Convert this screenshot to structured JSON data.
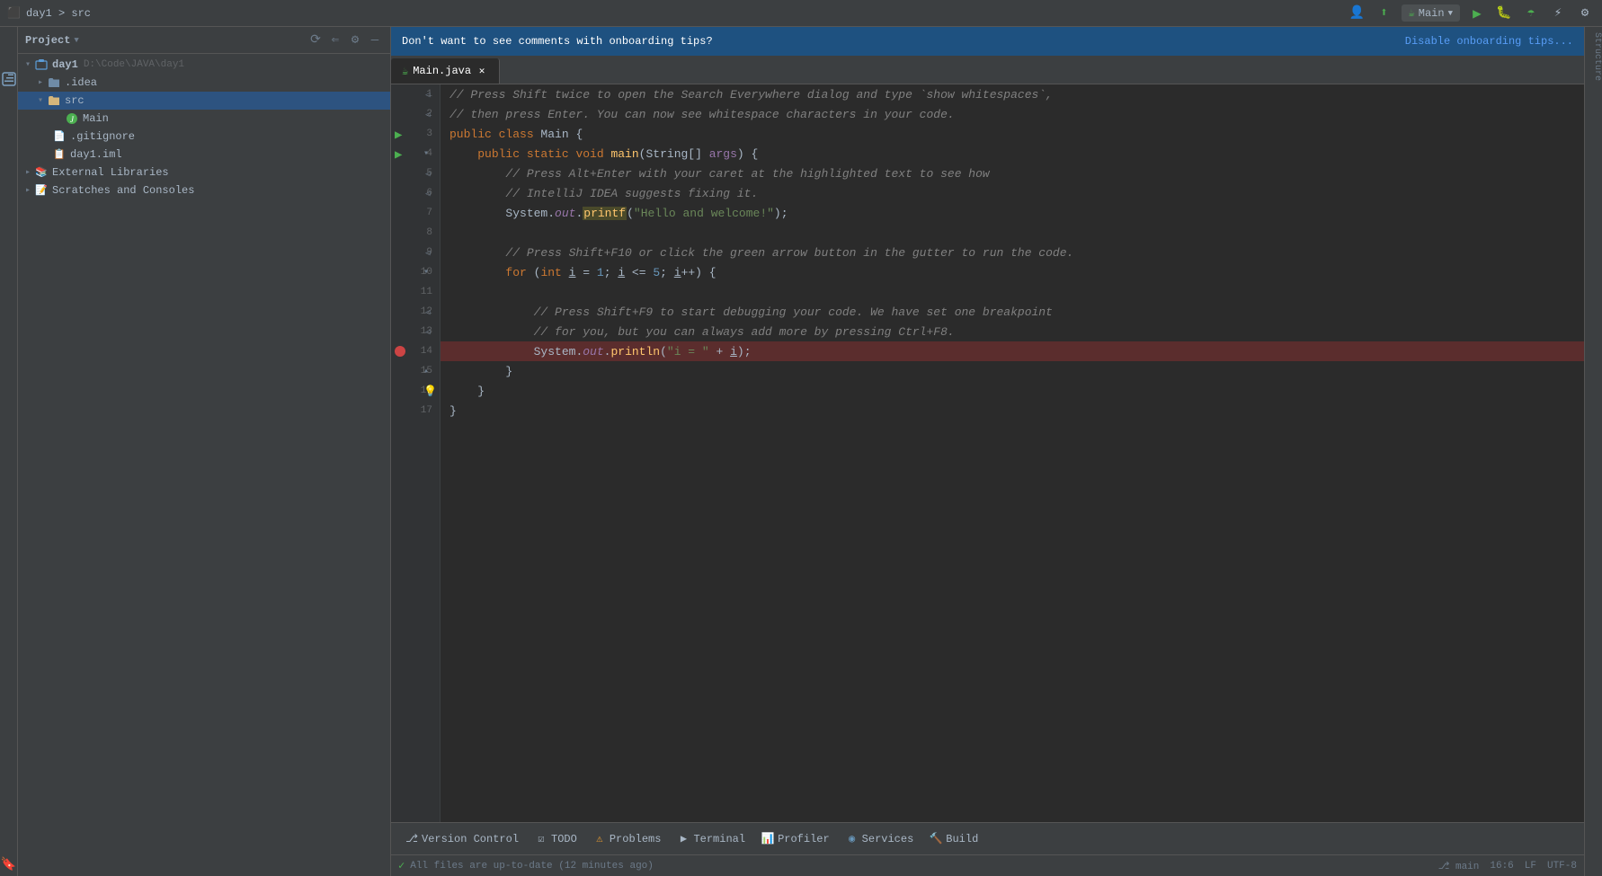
{
  "titleBar": {
    "breadcrumb": "day1 > src",
    "runConfig": {
      "label": "Main",
      "dropdownIcon": "▼"
    },
    "buttons": {
      "updateButton": "⬆",
      "runButton": "▶",
      "debugButton": "🐛",
      "coverageButton": "☂",
      "profileButton": "⚡",
      "settingsButton": "⚙",
      "accountButton": "👤",
      "minimizeButton": "—",
      "maximizeButton": "□",
      "closeButton": "✕"
    }
  },
  "notification": {
    "text": "Don't want to see comments with onboarding tips?",
    "action": "Disable onboarding tips..."
  },
  "tabs": [
    {
      "label": "Main.java",
      "active": true,
      "icon": "☕"
    }
  ],
  "projectPanel": {
    "title": "Project",
    "tree": [
      {
        "level": 0,
        "label": "day1",
        "path": "D:\\Code\\JAVA\\day1",
        "type": "module",
        "expanded": true,
        "selected": false
      },
      {
        "level": 1,
        "label": ".idea",
        "type": "folder",
        "expanded": false,
        "selected": false
      },
      {
        "level": 1,
        "label": "src",
        "type": "folder-src",
        "expanded": true,
        "selected": true
      },
      {
        "level": 2,
        "label": "Main",
        "type": "java",
        "selected": false
      },
      {
        "level": 1,
        "label": ".gitignore",
        "type": "gitignore",
        "selected": false
      },
      {
        "level": 1,
        "label": "day1.iml",
        "type": "iml",
        "selected": false
      },
      {
        "level": 0,
        "label": "External Libraries",
        "type": "ext-lib",
        "expanded": false,
        "selected": false
      },
      {
        "level": 0,
        "label": "Scratches and Consoles",
        "type": "scratches",
        "expanded": false,
        "selected": false
      }
    ]
  },
  "editor": {
    "lines": [
      {
        "num": 1,
        "content": "// Press Shift twice to open the Search Everywhere dialog and type `show whitespaces`,",
        "type": "comment"
      },
      {
        "num": 2,
        "content": "// then press Enter. You can now see whitespace characters in your code.",
        "type": "comment"
      },
      {
        "num": 3,
        "content": "public class Main {",
        "type": "code",
        "hasRunArrow": true
      },
      {
        "num": 4,
        "content": "    public static void main(String[] args) {",
        "type": "code",
        "hasFold": true
      },
      {
        "num": 5,
        "content": "        // Press Alt+Enter with your caret at the highlighted text to see how",
        "type": "comment"
      },
      {
        "num": 6,
        "content": "        // IntelliJ IDEA suggests fixing it.",
        "type": "comment"
      },
      {
        "num": 7,
        "content": "        System.out.printf(\"Hello and welcome!\");",
        "type": "code"
      },
      {
        "num": 8,
        "content": "",
        "type": "empty"
      },
      {
        "num": 9,
        "content": "        // Press Shift+F10 or click the green arrow button in the gutter to run the code.",
        "type": "comment"
      },
      {
        "num": 10,
        "content": "        for (int i = 1; i <= 5; i++) {",
        "type": "code",
        "hasFold": true
      },
      {
        "num": 11,
        "content": "",
        "type": "empty"
      },
      {
        "num": 12,
        "content": "            // Press Shift+F9 to start debugging your code. We have set one breakpoint",
        "type": "comment"
      },
      {
        "num": 13,
        "content": "            // for you, but you can always add more by pressing Ctrl+F8.",
        "type": "comment"
      },
      {
        "num": 14,
        "content": "            System.out.println(\"i = \" + i);",
        "type": "code",
        "hasBreakpoint": true
      },
      {
        "num": 15,
        "content": "        }",
        "type": "code",
        "hasFold": true
      },
      {
        "num": 16,
        "content": "    }",
        "type": "code",
        "hasBulb": true
      },
      {
        "num": 17,
        "content": "}",
        "type": "code"
      }
    ]
  },
  "bottomBar": {
    "buttons": [
      {
        "label": "Version Control",
        "icon": "⎇"
      },
      {
        "label": "TODO",
        "icon": "☑"
      },
      {
        "label": "Problems",
        "icon": "⚠"
      },
      {
        "label": "Terminal",
        "icon": "▶"
      },
      {
        "label": "Profiler",
        "icon": "📊"
      },
      {
        "label": "Services",
        "icon": "◉"
      },
      {
        "label": "Build",
        "icon": "🔨"
      }
    ]
  },
  "statusBar": {
    "left": "All files are up-to-date (12 minutes ago)",
    "position": "16:6",
    "encoding": "LF",
    "fileType": "UTF-8"
  }
}
